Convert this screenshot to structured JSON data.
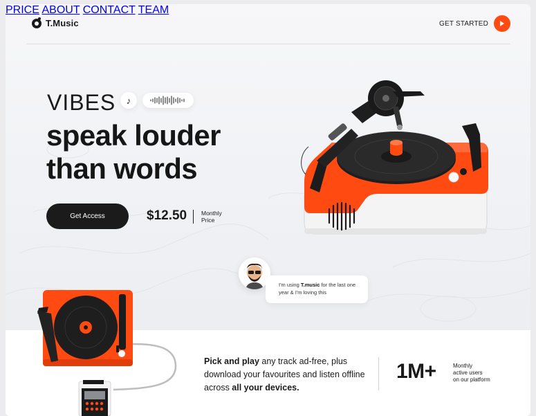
{
  "brand": {
    "name": "T.Music"
  },
  "nav": {
    "items": [
      {
        "label": "PRICE"
      },
      {
        "label": "ABOUT"
      },
      {
        "label": "CONTACT"
      },
      {
        "label": "TEAM"
      }
    ],
    "cta_label": "GET STARTED",
    "cta_icon": "arrow-right-icon"
  },
  "hero": {
    "eyebrow": "VIBES",
    "note_icon": "music-note-icon",
    "headline_line1": "speak louder",
    "headline_line2": "than words",
    "access_button": "Get Access",
    "price": "$12.50",
    "price_label_line1": "Monthly",
    "price_label_line2": "Price"
  },
  "testimonial": {
    "text_before": "I'm using ",
    "brand": "T.music",
    "text_after": " for the last one year & I'm loving this"
  },
  "band": {
    "text_bold1": "Pick and play",
    "text_mid": " any track ad-free, plus download your favourites and listen offline across ",
    "text_bold2": "all your devices.",
    "stat_value": "1M+",
    "stat_label_line1": "Monthly",
    "stat_label_line2": "active users",
    "stat_label_line3": "on our platform"
  },
  "colors": {
    "accent": "#ff4a12",
    "dark": "#1b1b1b",
    "background": "#f2f3f6"
  }
}
